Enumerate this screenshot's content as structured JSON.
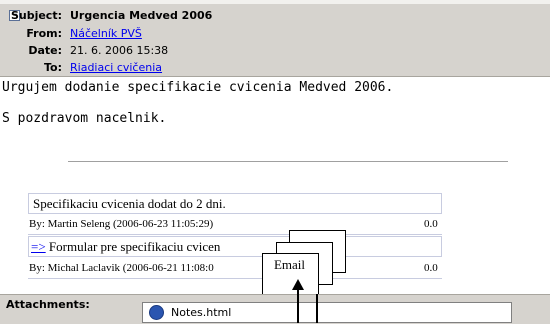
{
  "header": {
    "subject_label": "Subject:",
    "subject_value": "Urgencia Medved 2006",
    "from_label": "From:",
    "from_value": "Náčelník PVŠ",
    "date_label": "Date:",
    "date_value": "21. 6. 2006 15:38",
    "to_label": "To:",
    "to_value": "Riadiaci cvičenia",
    "collapse_glyph": "−"
  },
  "message": {
    "line1": "Urgujem dodanie specifikacie cvicenia Medved 2006.",
    "line2": "S pozdravom nacelnik."
  },
  "thread": [
    {
      "title": "Specifikaciu cvicenia dodat do 2 dni.",
      "by": "By: Martin Seleng (2006-06-23 11:05:29)",
      "score": "0.0"
    },
    {
      "arrow": "=>",
      "title": "Formular pre specifikaciu cvicen",
      "by": "By: Michal Laclavik (2006-06-21 11:08:0",
      "score": "0.0"
    }
  ],
  "overlay": {
    "card_label": "Email"
  },
  "attachments": {
    "label": "Attachments:",
    "file_name": "Notes.html"
  }
}
